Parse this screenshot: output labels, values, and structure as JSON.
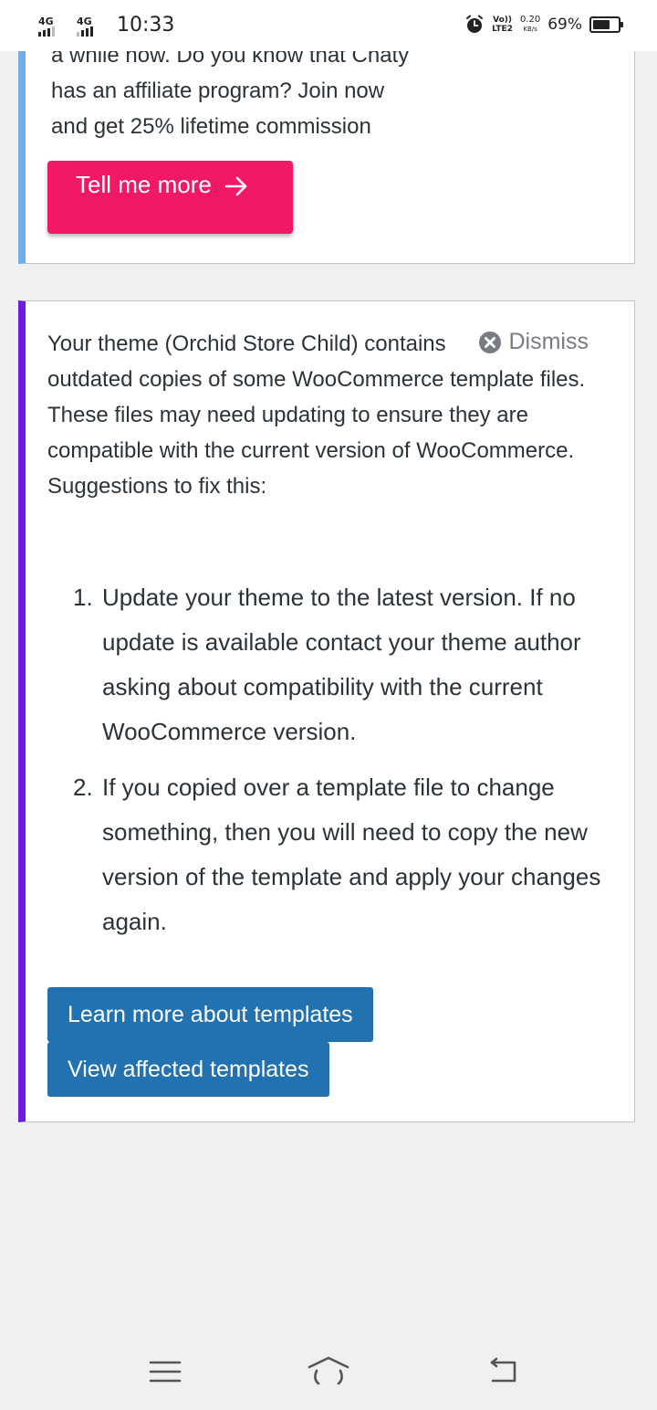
{
  "status_bar": {
    "signal_1_label": "4G",
    "signal_2_label": "4G",
    "time": "10:33",
    "volte_line1": "Vo))",
    "volte_line2": "LTE2",
    "speed_value": "0.20",
    "speed_unit": "KB/s",
    "battery_percent": "69%",
    "battery_level": 0.69,
    "icons": [
      "signal-icon",
      "alarm-icon",
      "battery-icon"
    ]
  },
  "notice_affiliate": {
    "text_lines": [
      "a while now. Do you know that Chaty",
      "has an affiliate program? Join now",
      "and get 25% lifetime commission"
    ],
    "button_label": "Tell me more",
    "button_icon": "arrow-right-icon",
    "accent_color": "#72aee6",
    "button_color": "#f31867"
  },
  "notice_templates": {
    "message": "Your theme (Orchid Store Child) contains outdated copies of some WooCommerce template files. These files may need updating to ensure they are compatible with the current version of WooCommerce. Suggestions to fix this:",
    "dismiss_label": "Dismiss",
    "dismiss_icon": "close-circle-icon",
    "steps": [
      {
        "number": "1.",
        "text": "Update your theme to the latest version. If no update is available contact your theme author asking about compatibility with the current WooCommerce version."
      },
      {
        "number": "2.",
        "text": "If you copied over a template file to change something, then you will need to copy the new version of the template and apply your changes again."
      }
    ],
    "learn_more_label": "Learn more about templates",
    "view_affected_label": "View affected templates",
    "accent_color": "#6e1bdf",
    "button_color": "#2271b1"
  },
  "nav_bar": {
    "icons": [
      "menu-icon",
      "home-icon",
      "back-icon"
    ]
  }
}
